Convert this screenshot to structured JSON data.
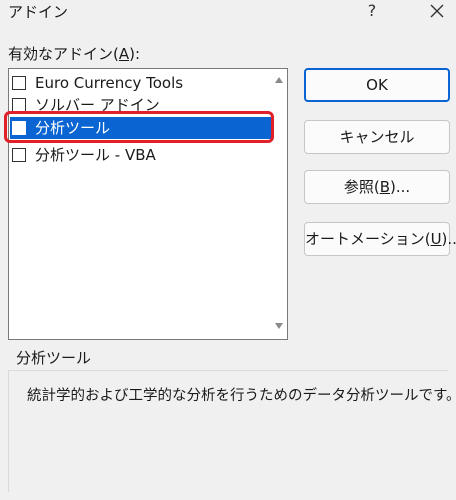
{
  "window": {
    "title": "アドイン",
    "help_label": "?"
  },
  "addins": {
    "label": "有効なアドイン(",
    "label_accel": "A",
    "label_tail": "):",
    "items": [
      {
        "label": "Euro Currency Tools",
        "checked": false,
        "selected": false
      },
      {
        "label": "ソルバー アドイン",
        "checked": false,
        "selected": false
      },
      {
        "label": "分析ツール",
        "checked": false,
        "selected": true
      },
      {
        "label": "分析ツール - VBA",
        "checked": false,
        "selected": false
      }
    ]
  },
  "buttons": {
    "ok": "OK",
    "cancel": "キャンセル",
    "browse_prefix": "参照(",
    "browse_accel": "B",
    "browse_suffix": ")...",
    "automation_prefix": "オートメーション(",
    "automation_accel": "U",
    "automation_suffix": ")..."
  },
  "description": {
    "title": "分析ツール",
    "text": "統計学的および工学的な分析を行うためのデータ分析ツールです。"
  },
  "colors": {
    "selection": "#0a64d2",
    "highlight_ring": "#e0202a",
    "background": "#f0f0f0"
  }
}
